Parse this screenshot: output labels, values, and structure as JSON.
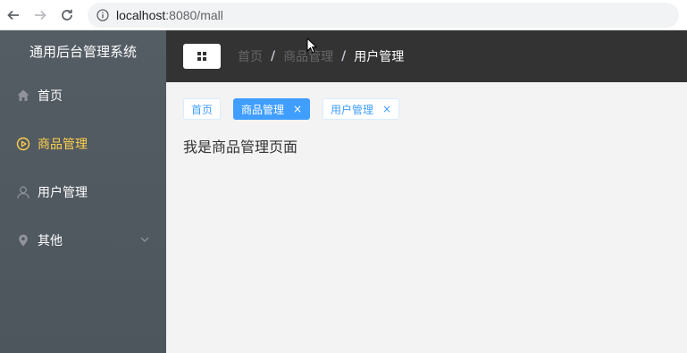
{
  "browser": {
    "url_host": "localhost",
    "url_path": ":8080/mall"
  },
  "sidebar": {
    "title": "通用后台管理系统",
    "items": [
      {
        "label": "首页",
        "icon": "home-icon"
      },
      {
        "label": "商品管理",
        "icon": "play-circle-icon",
        "active": true
      },
      {
        "label": "用户管理",
        "icon": "user-icon"
      },
      {
        "label": "其他",
        "icon": "location-icon",
        "has_submenu": true
      }
    ]
  },
  "header": {
    "breadcrumb": [
      "首页",
      "商品管理",
      "用户管理"
    ],
    "separator": "/"
  },
  "tags": [
    {
      "label": "首页"
    },
    {
      "label": "商品管理",
      "close": "×",
      "active": true
    },
    {
      "label": "用户管理",
      "close": "×"
    }
  ],
  "main": {
    "content_text": "我是商品管理页面"
  },
  "colors": {
    "sidebar_bg": "#545c64",
    "header_bg": "#333333",
    "active_menu": "#ffd04b",
    "tag_primary": "#409eff"
  }
}
